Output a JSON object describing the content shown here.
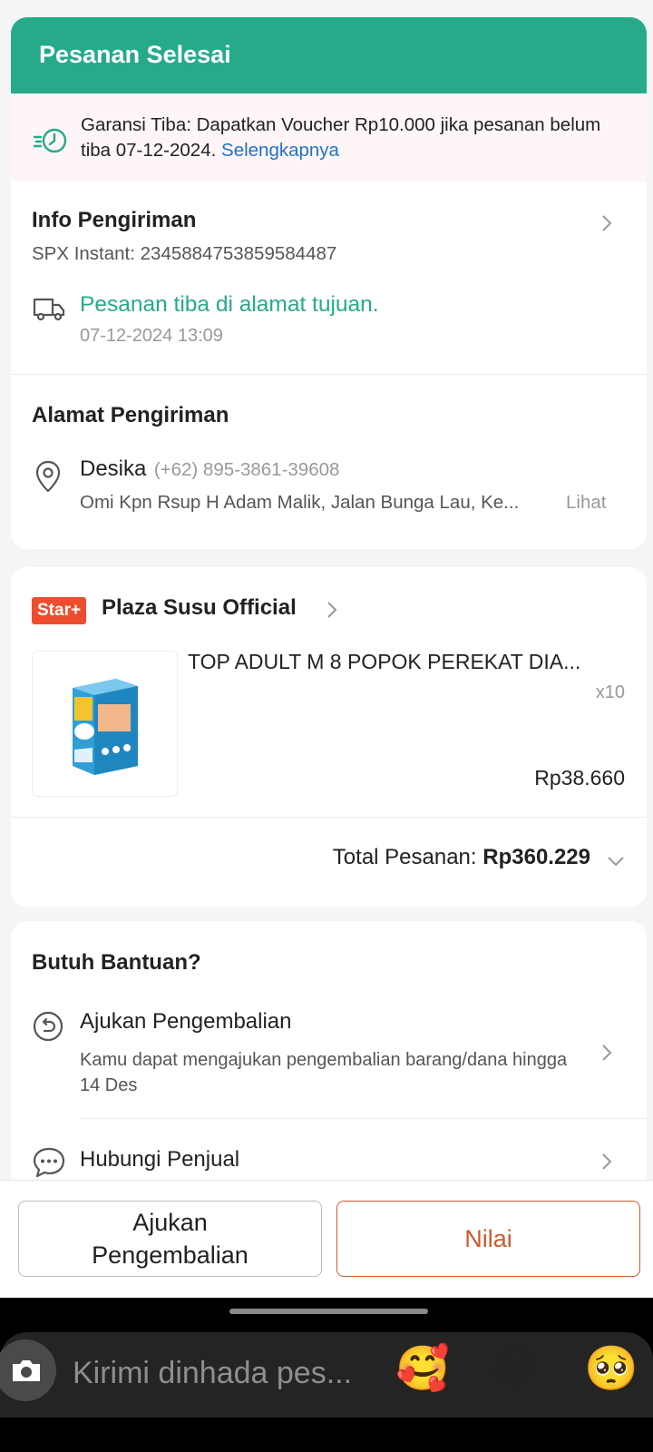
{
  "header": {
    "title": "Pesanan Selesai"
  },
  "warranty": {
    "text": "Garansi Tiba: Dapatkan Voucher Rp10.000 jika pesanan belum tiba 07-12-2024.",
    "link": "Selengkapnya"
  },
  "shipping_info": {
    "title": "Info Pengiriman",
    "tracking": "SPX Instant: 2345884753859584487",
    "status": "Pesanan tiba di alamat tujuan.",
    "timestamp": "07-12-2024 13:09"
  },
  "address": {
    "title": "Alamat Pengiriman",
    "name": "Desika",
    "phone": "(+62) 895-3861-39608",
    "line": "Omi Kpn Rsup H Adam Malik, Jalan Bunga Lau, Ke...",
    "view_label": "Lihat"
  },
  "shop": {
    "badge": "Star+",
    "name": "Plaza Susu Official",
    "product": {
      "name": "TOP ADULT M 8 POPOK PEREKAT DIA...",
      "quantity": "x10",
      "price": "Rp38.660"
    },
    "total_label": "Total Pesanan:",
    "total_value": "Rp360.229"
  },
  "help": {
    "title": "Butuh Bantuan?",
    "return_title": "Ajukan Pengembalian",
    "return_desc": "Kamu dapat mengajukan pengembalian barang/dana hingga 14 Des",
    "contact_title": "Hubungi Penjual"
  },
  "actions": {
    "return_button": "Ajukan Pengembalian",
    "rate_button": "Nilai"
  },
  "message_bar": {
    "placeholder": "Kirimi dinhada pes...",
    "emojis": [
      "🥰",
      "😂",
      "🥺"
    ]
  },
  "colors": {
    "header_green": "#26aa8a",
    "status_green": "#26aa8a",
    "accent_orange": "#d0592e",
    "link_blue": "#1e73c8",
    "star_badge": "#ee4d2d"
  }
}
